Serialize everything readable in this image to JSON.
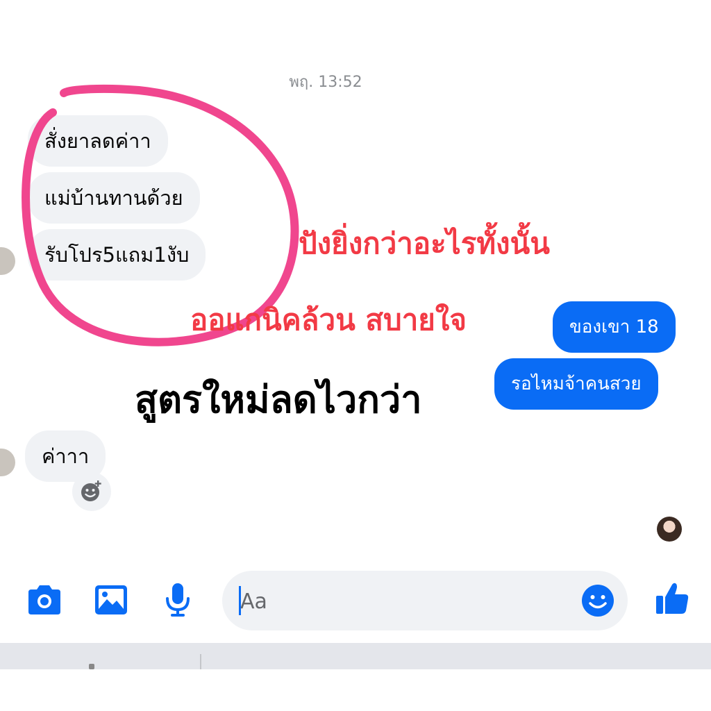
{
  "chat": {
    "timestamp": "พฤ. 13:52",
    "incoming": [
      {
        "text": "สั่งยาลดค่าา"
      },
      {
        "text": "แม่บ้านทานด้วย"
      },
      {
        "text": "รับโปร5แถม1งับ"
      },
      {
        "text": "ค่าาา"
      }
    ],
    "outgoing": [
      {
        "text": "ของเขา 18"
      },
      {
        "text": "รอไหมจ้าคนสวย"
      }
    ]
  },
  "overlay": {
    "line1": "ปังยิ่งกว่าอะไรทั้งนั้น",
    "line2": "ออแกนิคล้วน สบายใจ",
    "line3": "สูตรใหม่ลดไวกว่า"
  },
  "composer": {
    "placeholder": "Aa"
  },
  "colors": {
    "messenger_blue": "#0a6cf5",
    "bubble_gray": "#f0f2f5",
    "annotation_pink": "#f0468e",
    "overlay_red": "#f23a45"
  },
  "icons": {
    "camera": "camera-icon",
    "image": "image-icon",
    "microphone": "microphone-icon",
    "emoji": "emoji-icon",
    "like": "thumbs-up-icon",
    "add_reaction": "add-reaction-icon"
  }
}
